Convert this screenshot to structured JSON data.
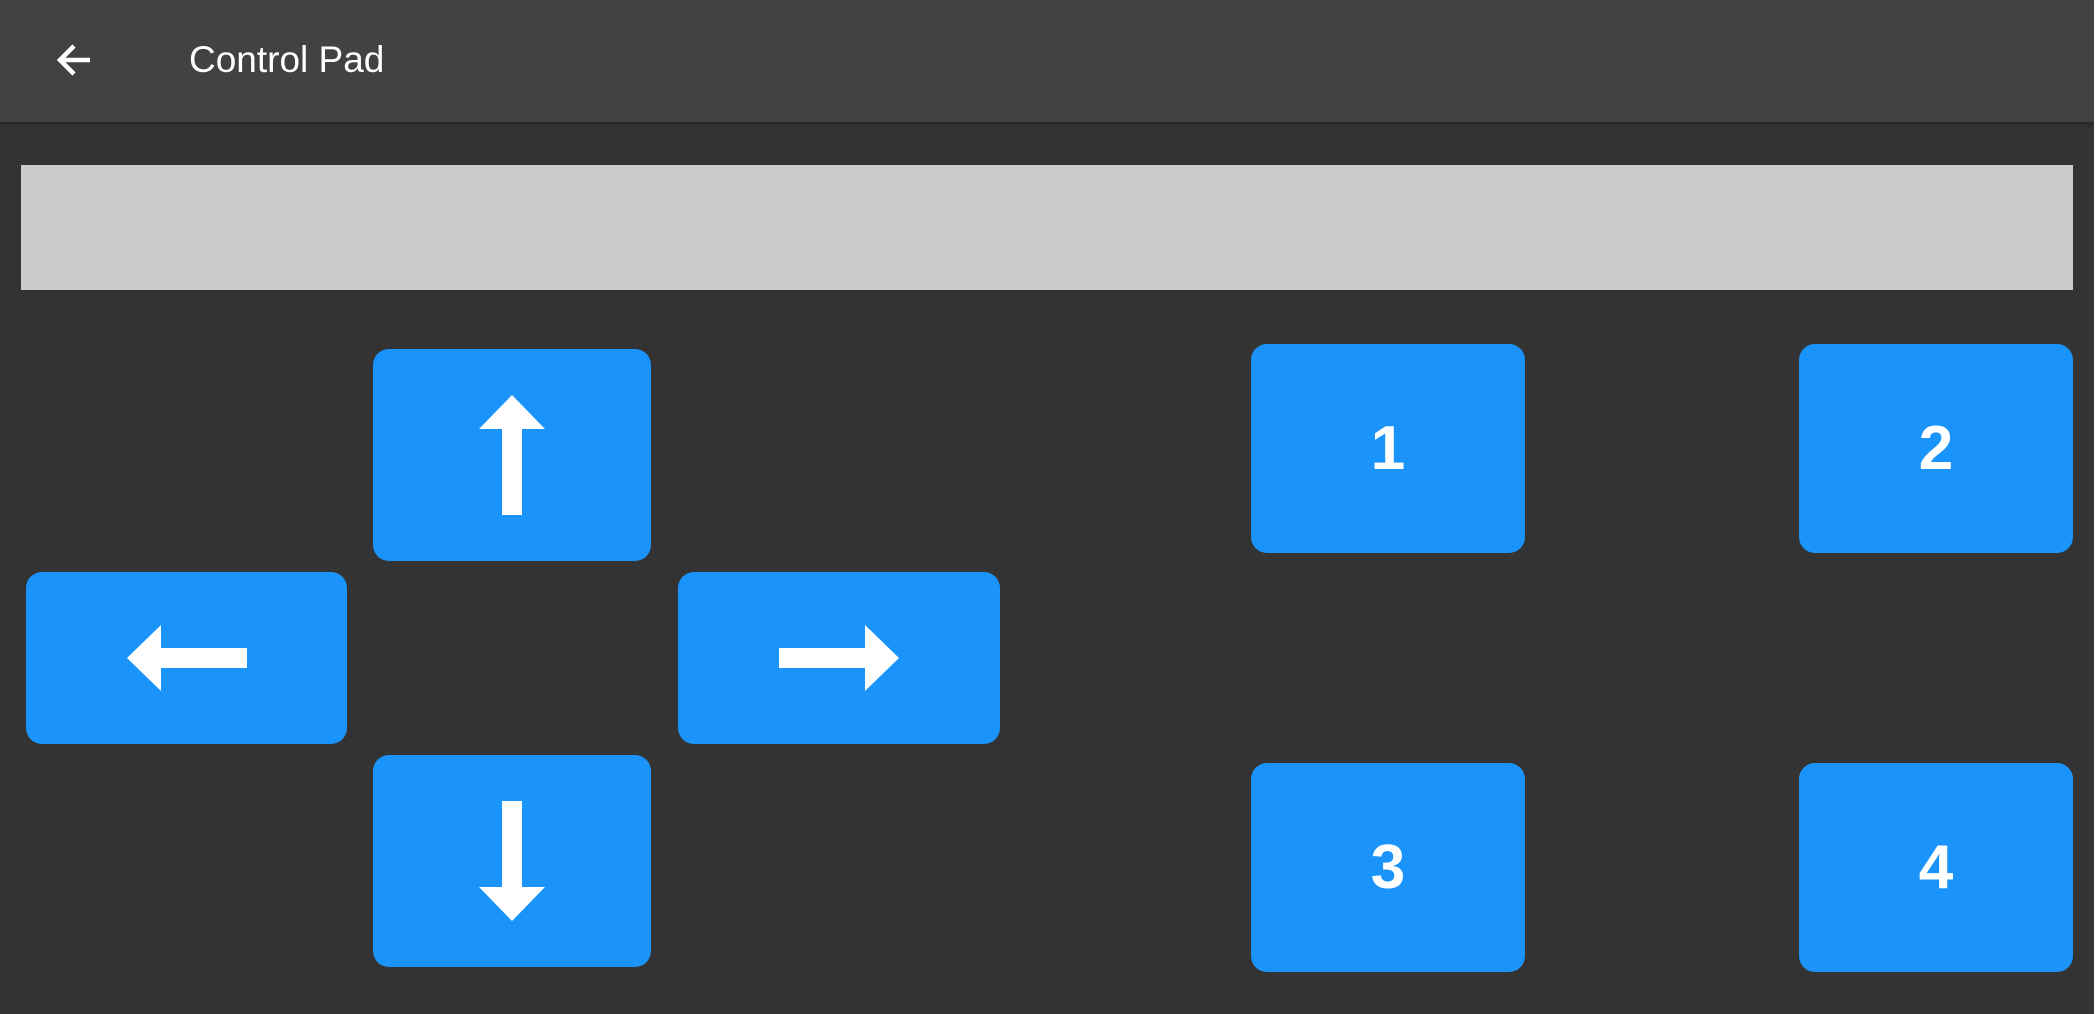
{
  "toolbar": {
    "title": "Control Pad",
    "back_icon": "arrow-left-icon"
  },
  "display": {
    "value": ""
  },
  "dpad": {
    "up_icon": "arrow-up-icon",
    "left_icon": "arrow-left-icon",
    "right_icon": "arrow-right-icon",
    "down_icon": "arrow-down-icon"
  },
  "buttons": [
    {
      "label": "1"
    },
    {
      "label": "2"
    },
    {
      "label": "3"
    },
    {
      "label": "4"
    }
  ],
  "colors": {
    "background": "#333333",
    "toolbar": "#424242",
    "button": "#1a94fb",
    "display": "#cccccc",
    "icon": "#ffffff"
  }
}
